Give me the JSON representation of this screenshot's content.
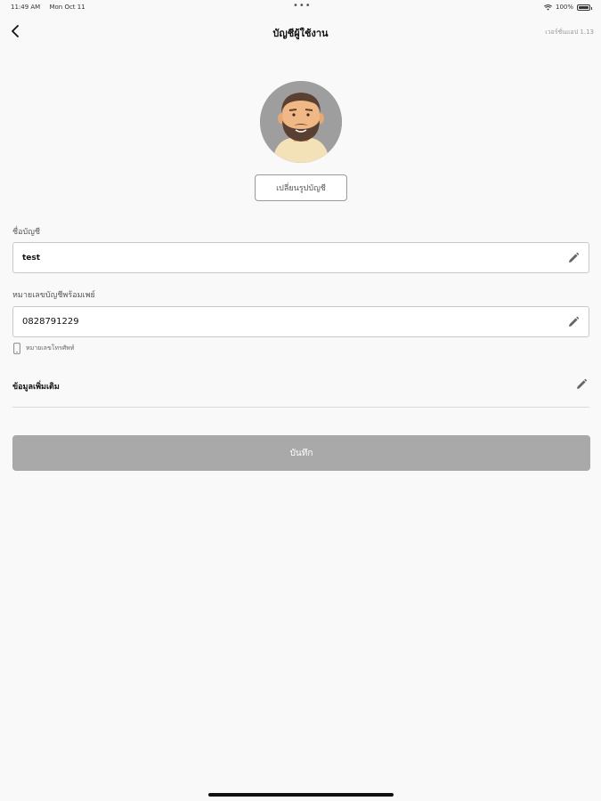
{
  "status_bar": {
    "time": "11:49 AM",
    "date": "Mon Oct 11",
    "battery": "100%"
  },
  "nav": {
    "title": "บัญชีผู้ใช้งาน",
    "version": "เวอร์ชั่นแอป 1.13"
  },
  "profile": {
    "change_photo_label": "เปลี่ยนรูปบัญชี"
  },
  "form": {
    "account_name_label": "ชื่อบัญชี",
    "account_name_value": "test",
    "promptpay_label": "หมายเลขบัญชีพร้อมเพย์",
    "promptpay_value": "0828791229",
    "phone_hint": "หมายเลขโทรศัพท์",
    "additional_info_label": "ข้อมูลเพิ่มเติม",
    "save_label": "บันทึก"
  },
  "icons": {
    "back": "chevron-left-icon",
    "edit": "pencil-icon",
    "wifi": "wifi-icon",
    "battery": "battery-icon",
    "phone": "mobile-phone-icon"
  },
  "colors": {
    "save_button": "#a9a9a9",
    "background": "#f9f9f9",
    "avatar_bg": "#9e9e9e"
  }
}
